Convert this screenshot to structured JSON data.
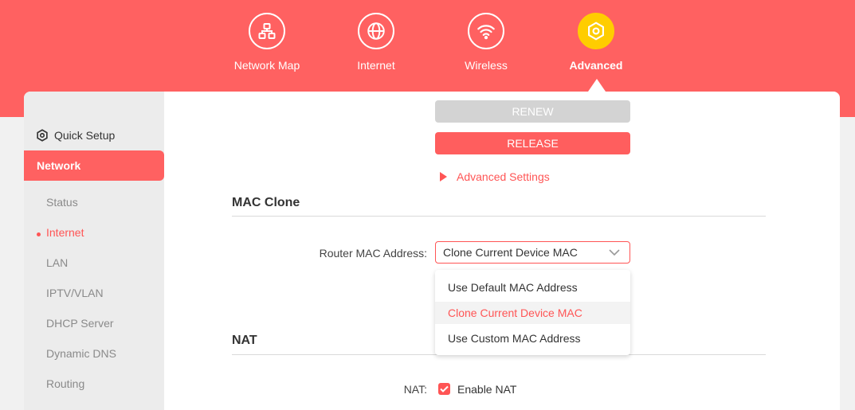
{
  "nav": {
    "items": [
      {
        "label": "Network Map",
        "icon": "network-map-icon"
      },
      {
        "label": "Internet",
        "icon": "globe-icon"
      },
      {
        "label": "Wireless",
        "icon": "wifi-icon"
      },
      {
        "label": "Advanced",
        "icon": "gear-icon",
        "active": true
      }
    ]
  },
  "sidebar": {
    "quick_setup": "Quick Setup",
    "network": "Network",
    "items": [
      "Status",
      "Internet",
      "LAN",
      "IPTV/VLAN",
      "DHCP Server",
      "Dynamic DNS",
      "Routing"
    ],
    "active_item": "Internet"
  },
  "main": {
    "renew_label": "RENEW",
    "release_label": "RELEASE",
    "advanced_settings": "Advanced Settings",
    "mac_clone": {
      "title": "MAC Clone",
      "router_mac_label": "Router MAC Address:",
      "selected": "Clone Current Device MAC",
      "options": [
        "Use Default MAC Address",
        "Clone Current Device MAC",
        "Use Custom MAC Address"
      ]
    },
    "nat": {
      "title": "NAT",
      "label": "NAT:",
      "checkbox_label": "Enable NAT",
      "checked": true
    }
  },
  "colors": {
    "brand": "#ff6161",
    "accent_active": "#ffcd00",
    "disabled": "#d3d3d3"
  }
}
